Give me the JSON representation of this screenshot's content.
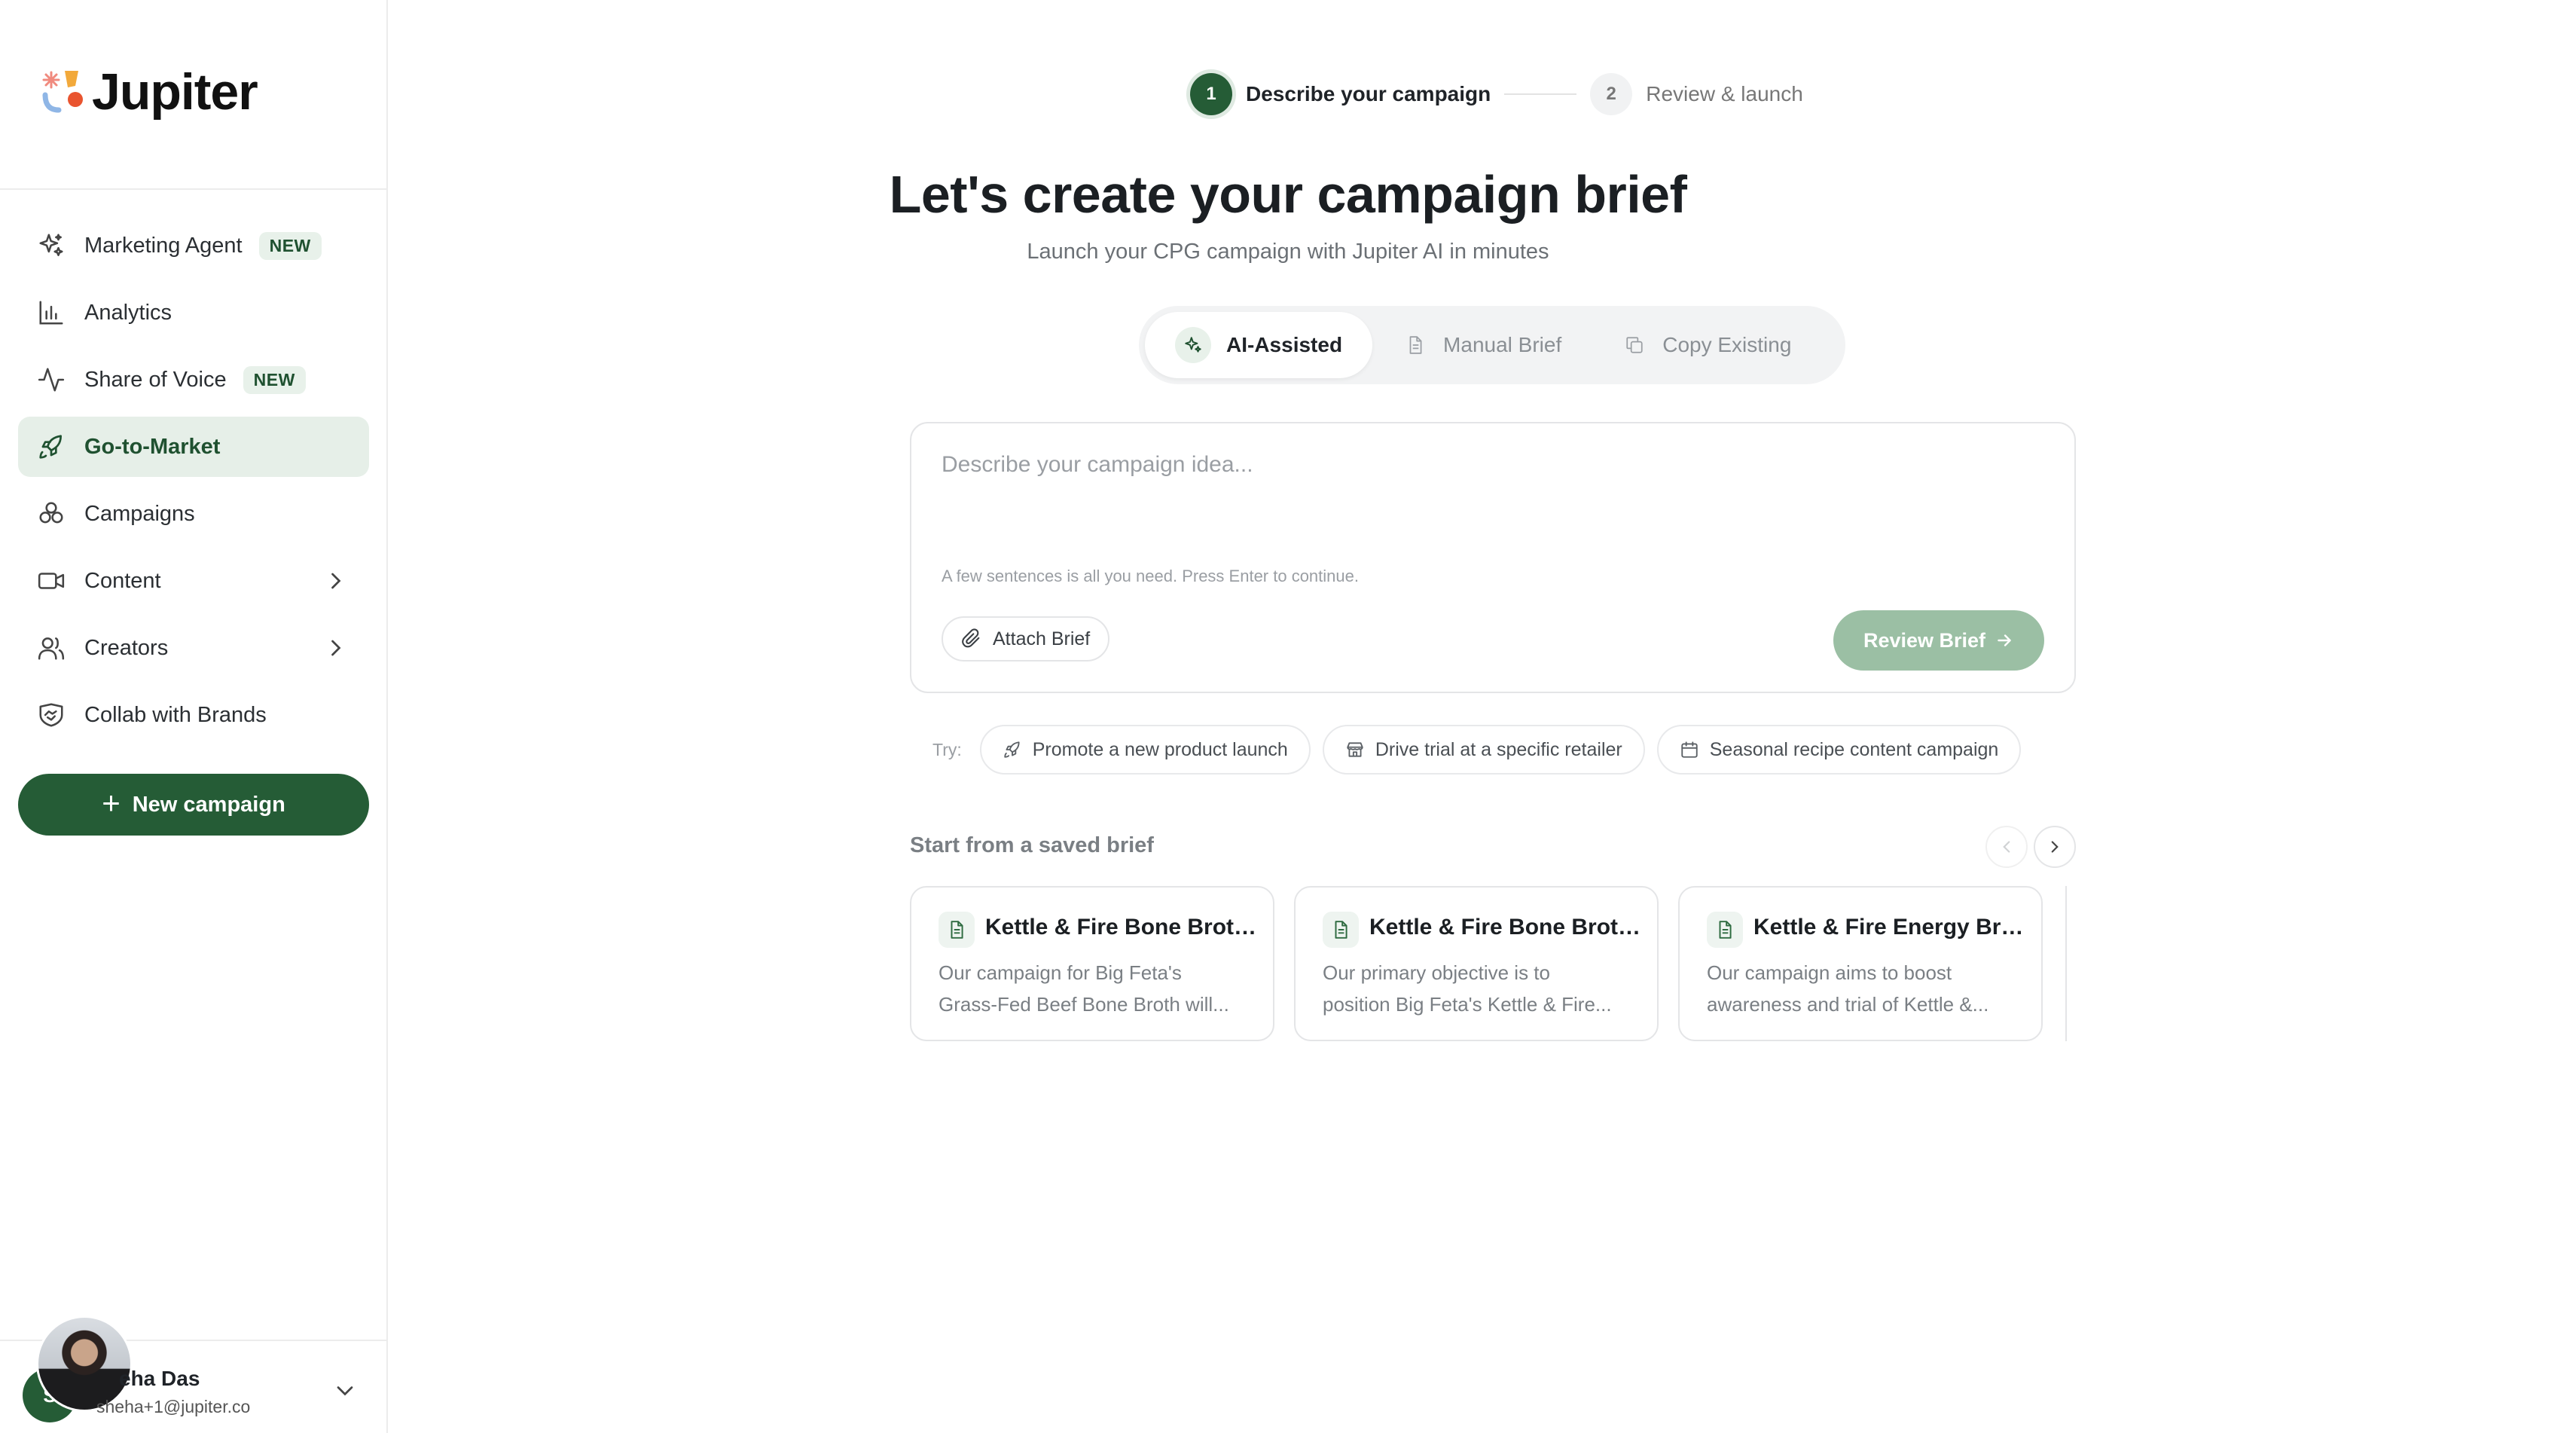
{
  "brand": {
    "name": "Jupiter",
    "accent": "#255c36",
    "accent_light": "#e6efe8"
  },
  "sidebar": {
    "items": [
      {
        "label": "Marketing Agent",
        "icon": "sparkles-icon",
        "badge": "NEW"
      },
      {
        "label": "Analytics",
        "icon": "bar-chart-icon"
      },
      {
        "label": "Share of Voice",
        "icon": "activity-icon",
        "badge": "NEW"
      },
      {
        "label": "Go-to-Market",
        "icon": "rocket-icon",
        "active": true
      },
      {
        "label": "Campaigns",
        "icon": "cluster-icon"
      },
      {
        "label": "Content",
        "icon": "video-icon",
        "expandable": true
      },
      {
        "label": "Creators",
        "icon": "users-icon",
        "expandable": true
      },
      {
        "label": "Collab with Brands",
        "icon": "handshake-icon"
      }
    ],
    "new_campaign_label": "New campaign",
    "user": {
      "initials": "S",
      "name": "eha Das",
      "email": "sheha+1@jupiter.co"
    }
  },
  "stepper": {
    "steps": [
      {
        "number": "1",
        "label": "Describe your campaign",
        "state": "active"
      },
      {
        "number": "2",
        "label": "Review & launch",
        "state": "idle"
      }
    ]
  },
  "main": {
    "title": "Let's create your campaign brief",
    "subtitle": "Launch your CPG campaign with Jupiter AI in minutes",
    "modes": [
      {
        "label": "AI-Assisted",
        "icon": "sparkles-icon",
        "active": true
      },
      {
        "label": "Manual Brief",
        "icon": "document-icon"
      },
      {
        "label": "Copy Existing",
        "icon": "copy-icon"
      }
    ],
    "composer": {
      "placeholder": "Describe your campaign idea...",
      "hint": "A few sentences is all you need. Press Enter to continue.",
      "attach_label": "Attach Brief",
      "review_label": "Review Brief"
    },
    "try": {
      "label": "Try:",
      "chips": [
        {
          "label": "Promote a new product launch",
          "icon": "rocket-icon"
        },
        {
          "label": "Drive trial at a specific retailer",
          "icon": "store-icon"
        },
        {
          "label": "Seasonal recipe content campaign",
          "icon": "calendar-icon"
        }
      ]
    },
    "saved": {
      "title": "Start from a saved brief",
      "cards": [
        {
          "title": "Kettle & Fire Bone Broth...",
          "line1": "Our campaign for Big Feta's",
          "line2": "Grass-Fed Beef Bone Broth will..."
        },
        {
          "title": "Kettle & Fire Bone Broth...",
          "line1": "Our primary objective is to",
          "line2": "position Big Feta's Kettle & Fire..."
        },
        {
          "title": "Kettle & Fire Energy Bro...",
          "line1": "Our campaign aims to boost",
          "line2": "awareness and trial of Kettle &..."
        }
      ]
    }
  }
}
